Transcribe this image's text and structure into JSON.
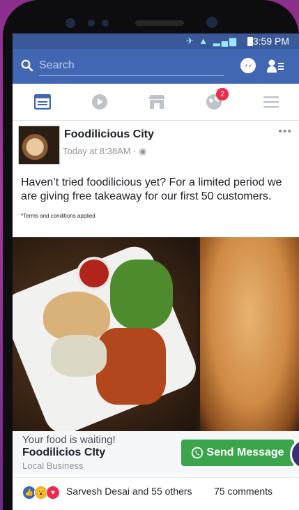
{
  "status_bar": {
    "time": "3:59 PM"
  },
  "search": {
    "placeholder": "Search"
  },
  "nav": {
    "notification_count": "2"
  },
  "post": {
    "page_name": "Foodilicious City",
    "meta": "Today at 8:38AM",
    "text": "Haven’t tried foodilicious yet? For a limited period we are giving free takeaway for our first 50 customers.",
    "terms": "*Terms and conditions applied"
  },
  "cta": {
    "headline": "Your food is waiting!",
    "title": "Foodilicios CIty",
    "subtitle": "Local Business",
    "button_label": "Send Message"
  },
  "reactions": {
    "names": "Sarvesh Desai and 55 others",
    "comments": "75 comments"
  },
  "colors": {
    "facebook_blue": "#3b5998",
    "whatsapp_green": "#3aa54a",
    "badge_red": "#f02849"
  }
}
